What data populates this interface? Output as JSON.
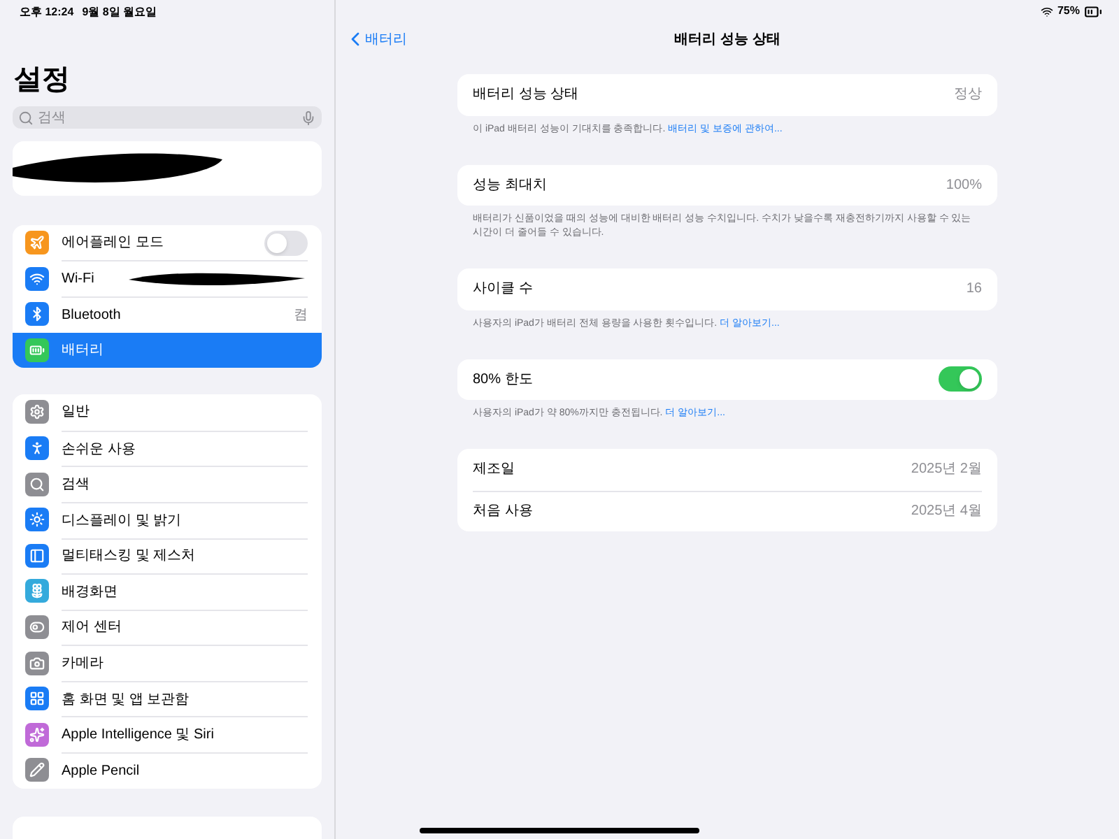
{
  "status_bar": {
    "time": "오후 12:24",
    "date": "9월 8일 월요일",
    "battery": "75%"
  },
  "sidebar": {
    "title": "설정",
    "search": {
      "placeholder": "검색"
    },
    "groups": [
      [
        {
          "label": "에어플레인 모드",
          "kind": "toggle",
          "on": false,
          "selected": false,
          "color": "#f7961e"
        },
        {
          "label": "Wi-Fi",
          "kind": "redacted",
          "selected": false,
          "color": "#1a7cf5"
        },
        {
          "label": "Bluetooth",
          "kind": "value",
          "value": "켬",
          "selected": false,
          "color": "#1a7cf5"
        },
        {
          "label": "배터리",
          "kind": "plain",
          "selected": true,
          "color": "#34c759"
        }
      ],
      [
        {
          "label": "일반",
          "kind": "plain",
          "selected": false,
          "color": "#8e8e93"
        },
        {
          "label": "손쉬운 사용",
          "kind": "plain",
          "selected": false,
          "color": "#1a7cf5"
        },
        {
          "label": "검색",
          "kind": "plain",
          "selected": false,
          "color": "#8e8e93"
        },
        {
          "label": "디스플레이 및 밝기",
          "kind": "plain",
          "selected": false,
          "color": "#1a7cf5"
        },
        {
          "label": "멀티태스킹 및 제스처",
          "kind": "plain",
          "selected": false,
          "color": "#1a7cf5"
        },
        {
          "label": "배경화면",
          "kind": "plain",
          "selected": false,
          "color": "#34aadc"
        },
        {
          "label": "제어 센터",
          "kind": "plain",
          "selected": false,
          "color": "#8e8e93"
        },
        {
          "label": "카메라",
          "kind": "plain",
          "selected": false,
          "color": "#8e8e93"
        },
        {
          "label": "홈 화면 및 앱 보관함",
          "kind": "plain",
          "selected": false,
          "color": "#1a7cf5"
        },
        {
          "label": "Apple Intelligence 및 Siri",
          "kind": "plain",
          "selected": false,
          "color": "#c06ad8"
        },
        {
          "label": "Apple Pencil",
          "kind": "plain",
          "selected": false,
          "color": "#8e8e93"
        }
      ]
    ]
  },
  "detail": {
    "back": "배터리",
    "title": "배터리 성능 상태",
    "sections": [
      {
        "rows": [
          {
            "label": "배터리 성능 상태",
            "kind": "value",
            "value": "정상"
          }
        ],
        "footnote": {
          "text": "이 iPad 배터리 성능이 기대치를 충족합니다.",
          "link": "배터리 및 보증에 관하여..."
        }
      },
      {
        "rows": [
          {
            "label": "성능 최대치",
            "kind": "value",
            "value": "100%"
          }
        ],
        "footnote": {
          "text": "배터리가 신품이었을 때의 성능에 대비한 배터리 성능 수치입니다. 수치가 낮을수록 재충전하기까지 사용할 수 있는 시간이 더 줄어들 수 있습니다."
        }
      },
      {
        "rows": [
          {
            "label": "사이클 수",
            "kind": "value",
            "value": "16"
          }
        ],
        "footnote": {
          "text": "사용자의 iPad가 배터리 전체 용량을 사용한 횟수입니다.",
          "link": "더 알아보기..."
        }
      },
      {
        "rows": [
          {
            "label": "80% 한도",
            "kind": "toggle",
            "on": true
          }
        ],
        "footnote": {
          "text": "사용자의 iPad가 약 80%까지만 충전됩니다.",
          "link": "더 알아보기..."
        }
      },
      {
        "rows": [
          {
            "label": "제조일",
            "kind": "value",
            "value": "2025년 2월"
          },
          {
            "label": "처음 사용",
            "kind": "value",
            "value": "2025년 4월"
          }
        ]
      }
    ]
  }
}
